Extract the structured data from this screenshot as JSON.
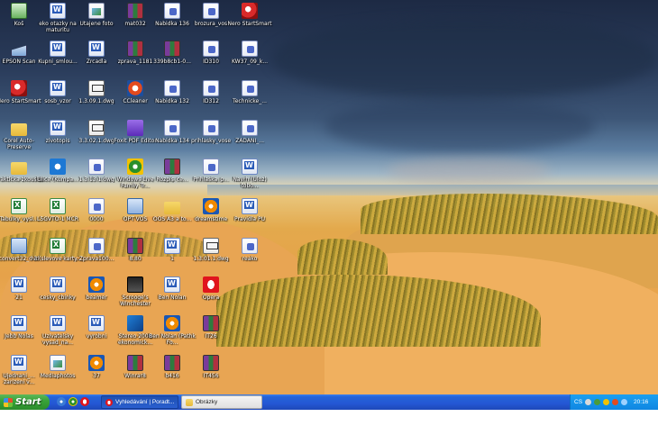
{
  "desktop": {
    "icons": [
      {
        "label": "Koš",
        "icon": "recycle-bin-icon",
        "kind": "bin"
      },
      {
        "label": "eko otazky na maturitu",
        "icon": "word-doc-icon",
        "kind": "word"
      },
      {
        "label": "Utajene foto",
        "icon": "image-file-icon",
        "kind": "img"
      },
      {
        "label": "mat032",
        "icon": "rar-archive-icon",
        "kind": "rar"
      },
      {
        "label": "Nabidka 136",
        "icon": "pdf-file-icon",
        "kind": "pdf"
      },
      {
        "label": "brozura_vos",
        "icon": "pdf-file-icon",
        "kind": "pdf"
      },
      {
        "label": "Nero StartSmart",
        "icon": "nero-icon",
        "kind": "nero"
      },
      {
        "label": "EPSON Scan",
        "icon": "scanner-icon",
        "kind": "scan"
      },
      {
        "label": "Kupni_smlou...",
        "icon": "word-doc-icon",
        "kind": "word"
      },
      {
        "label": "Zrcadla",
        "icon": "word-doc-icon",
        "kind": "word"
      },
      {
        "label": "zprava_1181",
        "icon": "rar-archive-icon",
        "kind": "rar"
      },
      {
        "label": "339b8cb1-0...",
        "icon": "rar-archive-icon",
        "kind": "rar"
      },
      {
        "label": "ID310",
        "icon": "pdf-file-icon",
        "kind": "pdf"
      },
      {
        "label": "KW37_09_k...",
        "icon": "pdf-file-icon",
        "kind": "pdf"
      },
      {
        "label": "Nero StartSmart",
        "icon": "nero-icon",
        "kind": "nero"
      },
      {
        "label": "sosb_vzor",
        "icon": "word-doc-icon",
        "kind": "word"
      },
      {
        "label": "1.3.09.1.dwg",
        "icon": "dwg-file-icon",
        "kind": "dwg"
      },
      {
        "label": "CCleaner",
        "icon": "ccleaner-icon",
        "kind": "cc"
      },
      {
        "label": "Nabidka 132",
        "icon": "pdf-file-icon",
        "kind": "pdf"
      },
      {
        "label": "ID312",
        "icon": "pdf-file-icon",
        "kind": "pdf"
      },
      {
        "label": "Technicke_...",
        "icon": "pdf-file-icon",
        "kind": "pdf"
      },
      {
        "label": "Corel Auto-Preserve",
        "icon": "folder-icon",
        "kind": "folder"
      },
      {
        "label": "zivotopis",
        "icon": "word-doc-icon",
        "kind": "word"
      },
      {
        "label": "3.3.02.1.dwg",
        "icon": "dwg-file-icon",
        "kind": "dwg"
      },
      {
        "label": "Foxit PDF Editor",
        "icon": "foxit-icon",
        "kind": "foxit"
      },
      {
        "label": "Nabidka 134",
        "icon": "pdf-file-icon",
        "kind": "pdf"
      },
      {
        "label": "prihlasky_vose",
        "icon": "pdf-file-icon",
        "kind": "pdf"
      },
      {
        "label": "ZADANI_...",
        "icon": "pdf-file-icon",
        "kind": "pdf"
      },
      {
        "label": "Prakticka zkouska",
        "icon": "folder-icon",
        "kind": "folder"
      },
      {
        "label": "Ulice (Kumpa...",
        "icon": "internet-explorer-icon",
        "kind": "ie"
      },
      {
        "label": "1.3.13.1.dwg",
        "icon": "pdf-file-icon",
        "kind": "pdf"
      },
      {
        "label": "Windows Live Family Tr...",
        "icon": "media-icon",
        "kind": "media"
      },
      {
        "label": "Rozpis_ce...",
        "icon": "rar-archive-icon",
        "kind": "rar"
      },
      {
        "label": "Prihlaska_p...",
        "icon": "pdf-file-icon",
        "kind": "pdf"
      },
      {
        "label": "Navrh (Uloz) tobo...",
        "icon": "word-doc-icon",
        "kind": "word"
      },
      {
        "label": "Tabulky_vysl...",
        "icon": "excel-file-icon",
        "kind": "excel"
      },
      {
        "label": "L5GVTO-1 MCR",
        "icon": "excel-file-icon",
        "kind": "excel"
      },
      {
        "label": "0000",
        "icon": "pdf-file-icon",
        "kind": "pdf"
      },
      {
        "label": "OPT VOS",
        "icon": "program-icon",
        "kind": "exe"
      },
      {
        "label": "OOS A3 a to...",
        "icon": "folder-icon",
        "kind": "folder"
      },
      {
        "label": "dreamstime",
        "icon": "video-icon",
        "kind": "video"
      },
      {
        "label": "Pravidla PU",
        "icon": "word-doc-icon",
        "kind": "word"
      },
      {
        "label": "convert32_dvd",
        "icon": "program-icon",
        "kind": "exe"
      },
      {
        "label": "3 (slevove karty...",
        "icon": "excel-file-icon",
        "kind": "excel"
      },
      {
        "label": "Zprava100...",
        "icon": "pdf-file-icon",
        "kind": "pdf"
      },
      {
        "label": "8.80",
        "icon": "rar-archive-icon",
        "kind": "rar"
      },
      {
        "label": "1",
        "icon": "word-doc-icon",
        "kind": "word"
      },
      {
        "label": "1.3.01.1.dwg",
        "icon": "dwg-file-icon",
        "kind": "dwg"
      },
      {
        "label": "reako",
        "icon": "pdf-file-icon",
        "kind": "pdf"
      },
      {
        "label": "21",
        "icon": "word-doc-icon",
        "kind": "word"
      },
      {
        "label": "cesky_cbinky",
        "icon": "word-doc-icon",
        "kind": "word"
      },
      {
        "label": "beamer",
        "icon": "video-icon",
        "kind": "video"
      },
      {
        "label": "Scrooge's Winchester",
        "icon": "dark-app-icon",
        "kind": "dark"
      },
      {
        "label": "Ben Nolan",
        "icon": "word-doc-icon",
        "kind": "word"
      },
      {
        "label": "Opera",
        "icon": "opera-icon",
        "kind": "opera"
      },
      {
        "label": "Jebb Nolas",
        "icon": "word-doc-icon",
        "kind": "word"
      },
      {
        "label": "Uzivatelsky vysad_na...",
        "icon": "word-doc-icon",
        "kind": "word"
      },
      {
        "label": "vyrobni",
        "icon": "word-doc-icon",
        "kind": "word"
      },
      {
        "label": "Stereo 2008 ekonomick...",
        "icon": "stereo-icon",
        "kind": "stereo"
      },
      {
        "label": "Ben Nolan (Pathk Fo...",
        "icon": "video-icon",
        "kind": "video"
      },
      {
        "label": "IT26",
        "icon": "rar-archive-icon",
        "kind": "rar"
      },
      {
        "label": "Ujednani_... zarizeni v...",
        "icon": "word-doc-icon",
        "kind": "word"
      },
      {
        "label": "Mediaphotos",
        "icon": "image-file-icon",
        "kind": "img"
      },
      {
        "label": "37",
        "icon": "video-icon",
        "kind": "video"
      },
      {
        "label": "Winrar8",
        "icon": "rar-archive-icon",
        "kind": "rar"
      },
      {
        "label": "b416",
        "icon": "rar-archive-icon",
        "kind": "rar"
      },
      {
        "label": "IT456",
        "icon": "rar-archive-icon",
        "kind": "rar"
      }
    ]
  },
  "taskbar": {
    "start_label": "Start",
    "tasks": [
      {
        "label": "Vyhledávání | Poradt...",
        "state": "active",
        "icon": "opera-icon"
      },
      {
        "label": "Obrázky",
        "state": "inactive",
        "icon": "folder-icon"
      }
    ],
    "tray": {
      "language": "CS",
      "clock": "20:16"
    }
  },
  "colors": {
    "taskbar_blue": "#2457d4",
    "start_green": "#39a33a",
    "tray_blue": "#0f86e2"
  }
}
